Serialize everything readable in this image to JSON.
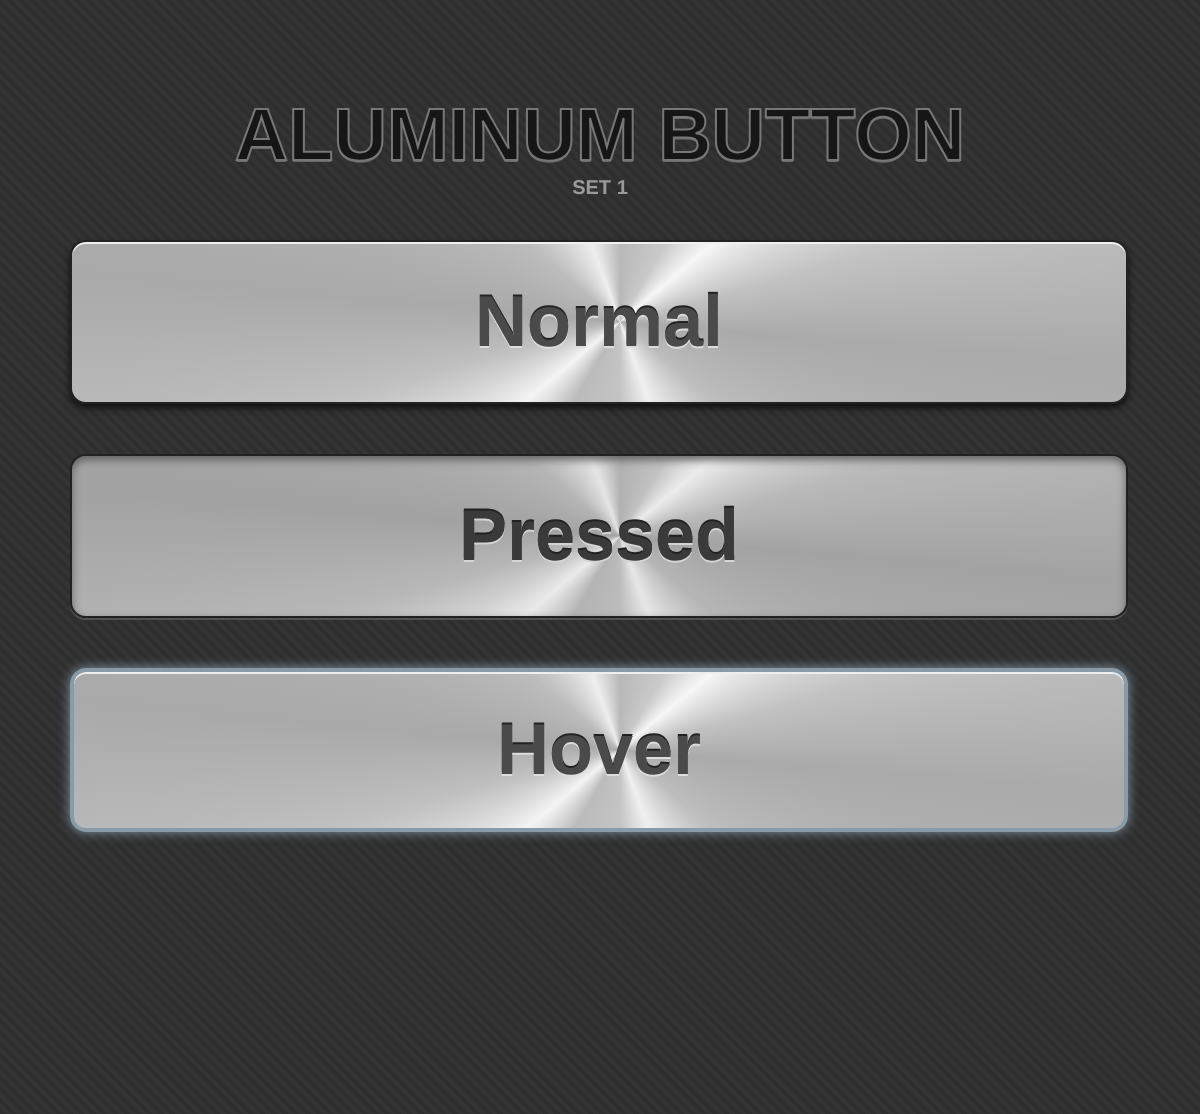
{
  "title": "ALUMINUM BUTTON",
  "subtitle": "SET 1",
  "buttons": [
    {
      "label": "Normal",
      "kind": "normal"
    },
    {
      "label": "Pressed",
      "kind": "pressed"
    },
    {
      "label": "Hover",
      "kind": "hover"
    }
  ]
}
